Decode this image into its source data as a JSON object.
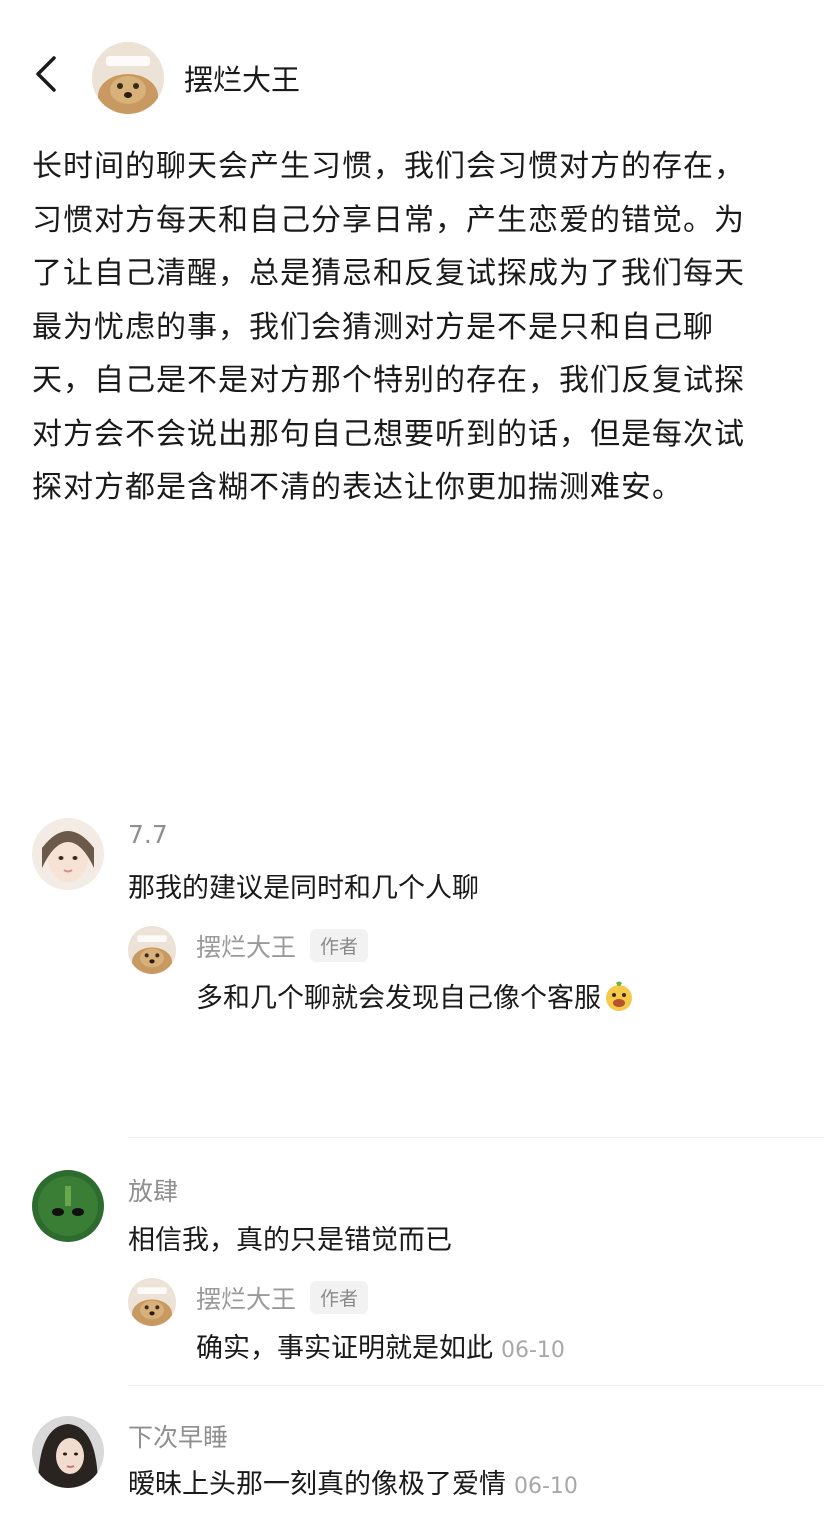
{
  "header": {
    "title": "摆烂大王",
    "avatar_icon": "dog-avatar-icon",
    "back_icon": "chevron-left-icon"
  },
  "post": {
    "text": "长时间的聊天会产生习惯，我们会习惯对方的存在，\n习惯对方每天和自己分享日常，产生恋爱的错觉。为\n了让自己清醒，总是猜忌和反复试探成为了我们每天\n最为忧虑的事，我们会猜测对方是不是只和自己聊\n天，自己是不是对方那个特别的存在，我们反复试探\n对方会不会说出那句自己想要听到的话，但是每次试\n探对方都是含糊不清的表达让你更加揣测难安。"
  },
  "comments": [
    {
      "user": "7.7",
      "text": "那我的建议是同时和几个人聊",
      "reply": {
        "user": "摆烂大王",
        "badge": "作者",
        "text": "多和几个聊就会发现自己像个客服",
        "emoji": "grinning-face-emoji"
      }
    },
    {
      "user": "放肆",
      "text": "相信我，真的只是错觉而已",
      "reply": {
        "user": "摆烂大王",
        "badge": "作者",
        "text": "确实，事实证明就是如此",
        "date": "06-10"
      }
    },
    {
      "user": "下次早睡",
      "text": "暧昧上头那一刻真的像极了爱情",
      "date": "06-10"
    }
  ],
  "colors": {
    "text": "#1a1a1a",
    "muted": "#8f8f8f",
    "badge_bg": "#f2f2f2"
  }
}
